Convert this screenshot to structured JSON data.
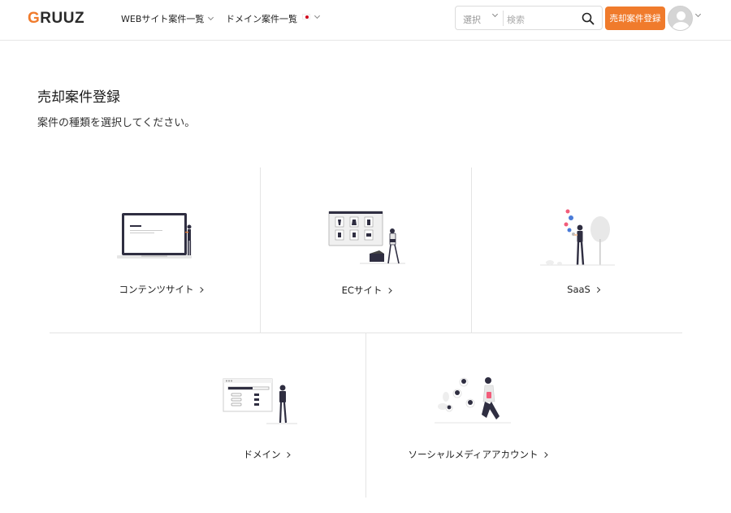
{
  "header": {
    "logo_g": "G",
    "logo_rest": "RUUZ",
    "nav": {
      "web_cases": "WEBサイト案件一覧",
      "domain_cases": "ドメイン案件一覧"
    },
    "search": {
      "select_label": "選択",
      "placeholder": "検索"
    },
    "register_button": "売却案件登録"
  },
  "main": {
    "title": "売却案件登録",
    "subtitle": "案件の種類を選択してください。",
    "categories": [
      {
        "label": "コンテンツサイト",
        "icon": "laptop-illustration"
      },
      {
        "label": "ECサイト",
        "icon": "ecommerce-illustration"
      },
      {
        "label": "SaaS",
        "icon": "saas-illustration"
      },
      {
        "label": "ドメイン",
        "icon": "domain-illustration"
      },
      {
        "label": "ソーシャルメディアアカウント",
        "icon": "social-media-illustration"
      }
    ]
  },
  "colors": {
    "accent": "#f07b2c",
    "text": "#222222",
    "border": "#e4e4e4"
  }
}
